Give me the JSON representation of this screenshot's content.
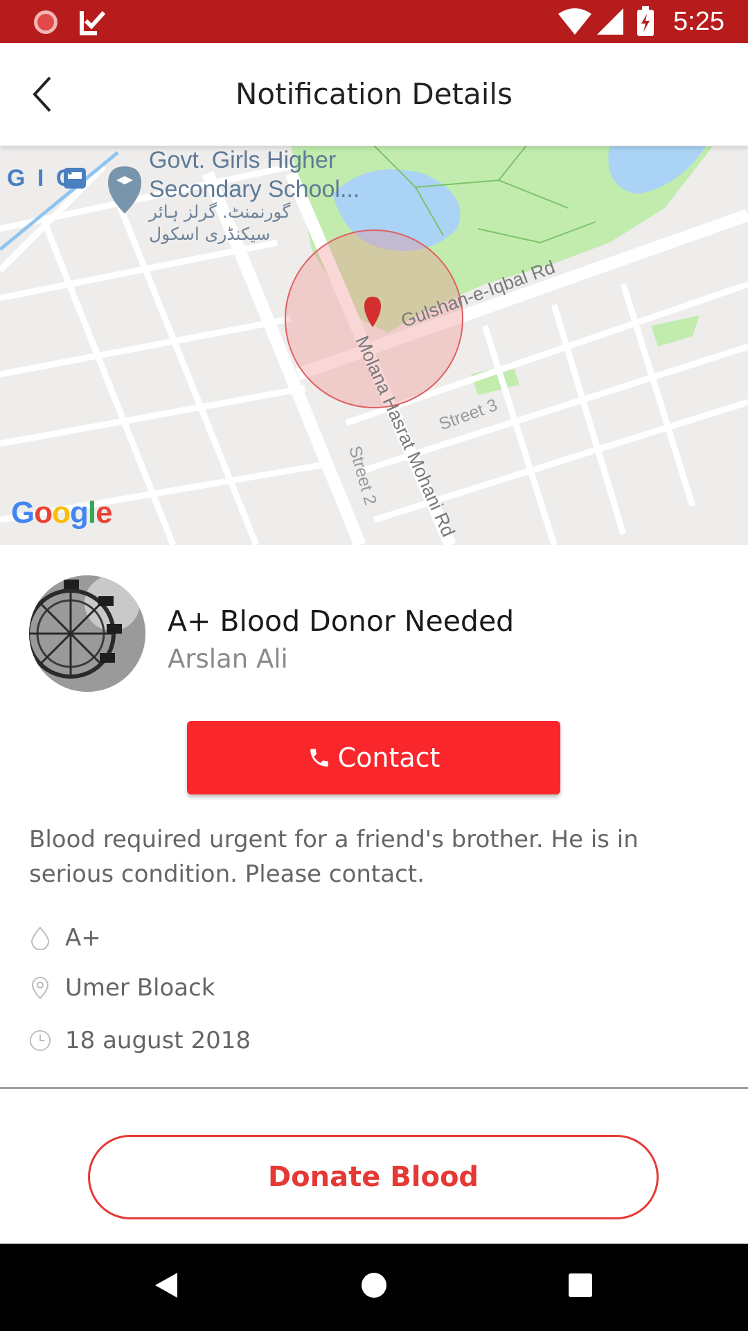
{
  "status_bar": {
    "time": "5:25",
    "icons": [
      "app-icon",
      "check-app-icon",
      "wifi-icon",
      "signal-icon",
      "battery-charging-icon"
    ]
  },
  "app_bar": {
    "title": "Notification Details",
    "back_icon": "back-arrow-icon"
  },
  "map": {
    "labels": {
      "school_line1": "Govt. Girls Higher",
      "school_line2": "Secondary School...",
      "school_urdu_line1": "گورنمنٹ. گرلز ہائر",
      "school_urdu_line2": "سیکنڈری اسکول",
      "gic": "G I C",
      "road_gulshan": "Gulshan-e-Iqbal Rd",
      "road_molana": "Molana Hasrat Mohani Rd",
      "street3": "Street 3",
      "street2": "Street 2",
      "google": "Google"
    },
    "colors": {
      "radius_fill": "#f28b8b",
      "marker": "#d32f2f",
      "park": "#c2ecae",
      "water": "#aad3f5"
    }
  },
  "request": {
    "title": "A+ Blood Donor Needed",
    "requester": "Arslan Ali",
    "contact_label": "Contact",
    "description": "Blood required urgent for a friend's brother. He is in serious condition. Please contact.",
    "blood_group": "A+",
    "location": "Umer Bloack",
    "date": "18 august 2018"
  },
  "actions": {
    "donate_label": "Donate Blood"
  },
  "theme": {
    "primary": "#f9272b",
    "status_bar": "#b71c1c",
    "donate_outline": "#e53935"
  }
}
